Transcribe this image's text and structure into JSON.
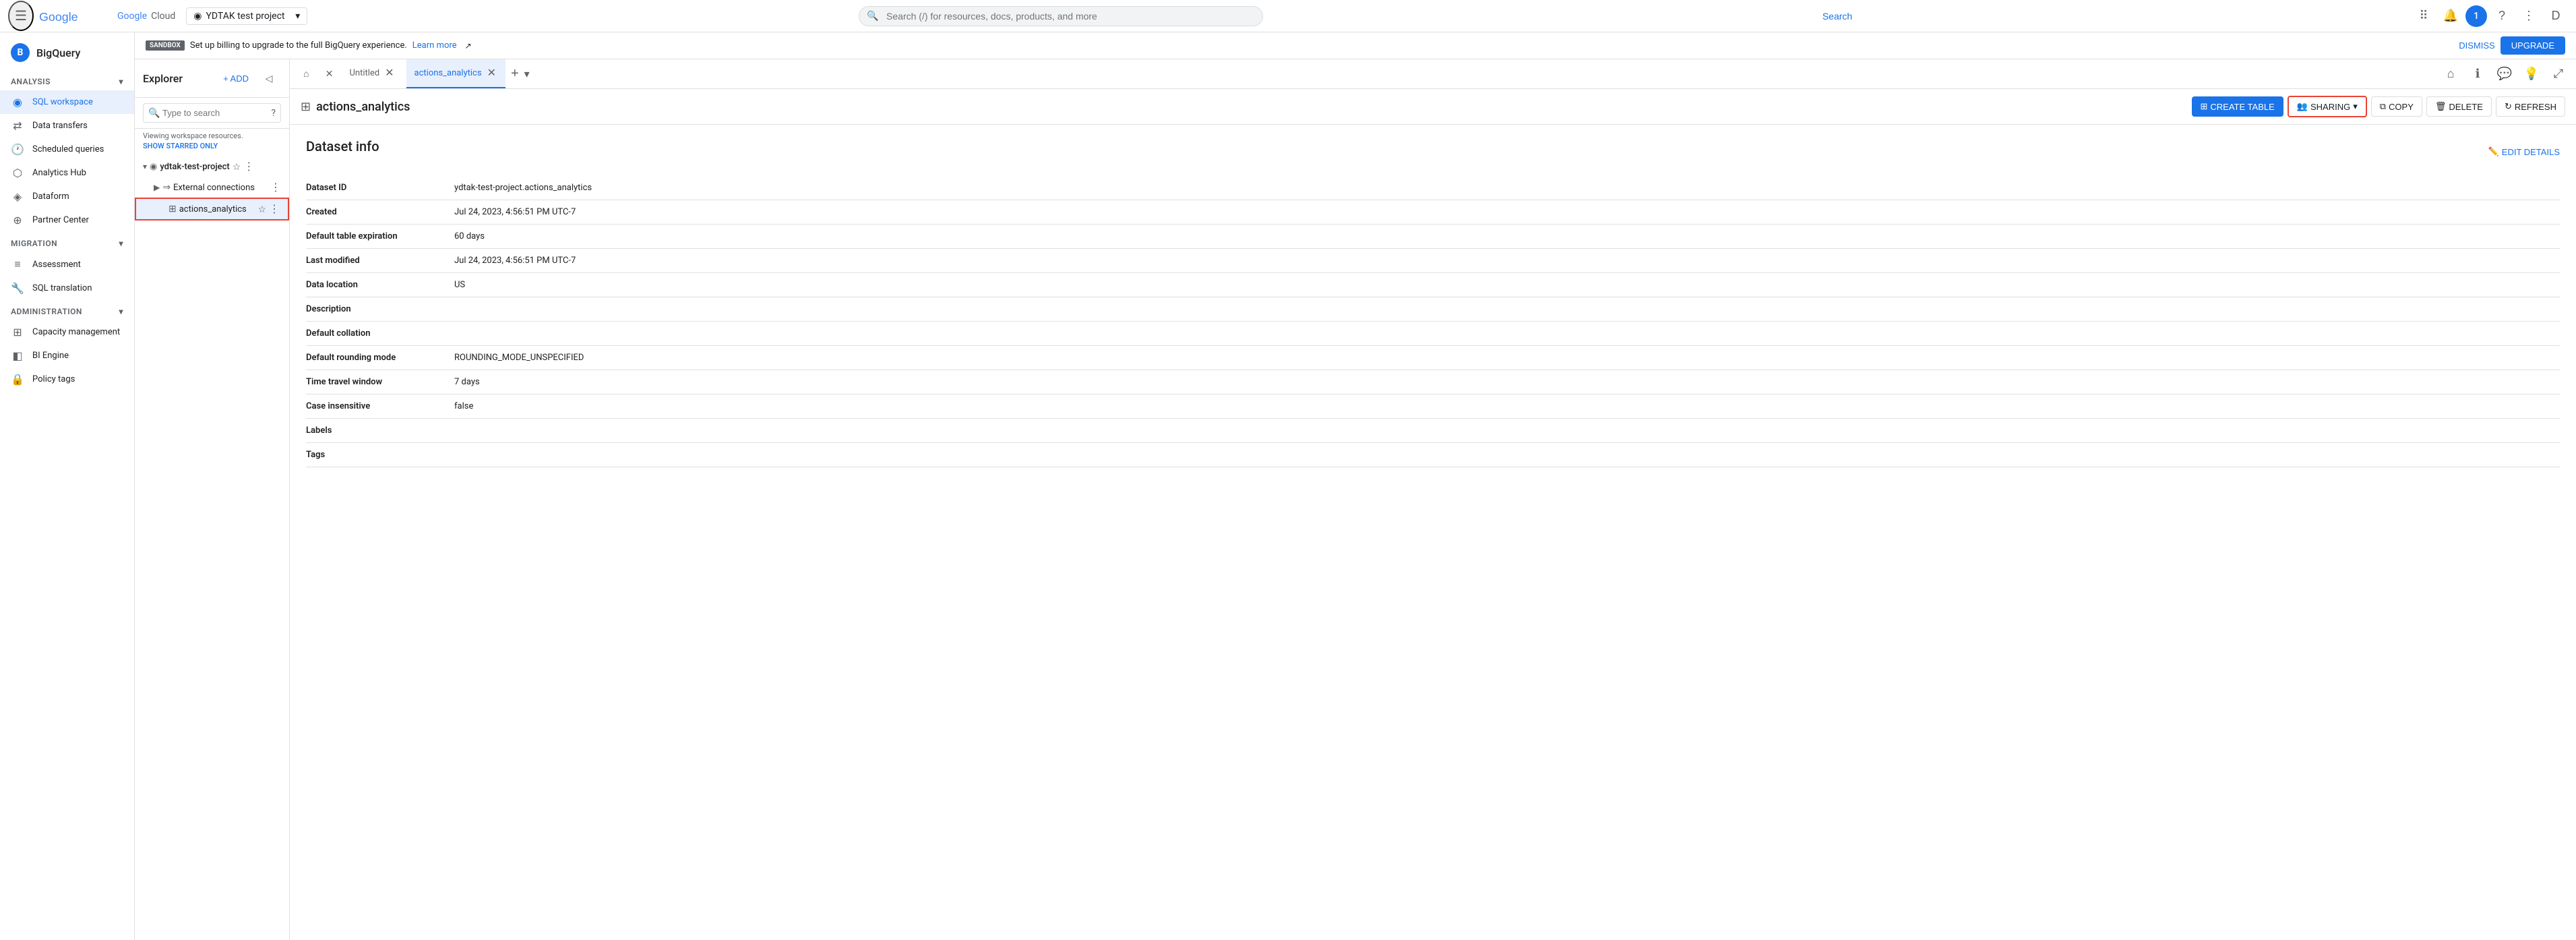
{
  "topbar": {
    "project_name": "YDTAK test project",
    "search_placeholder": "Search (/) for resources, docs, products, and more",
    "search_btn": "Search",
    "avatar_letter": "1"
  },
  "sandbox": {
    "badge": "SANDBOX",
    "message": "Set up billing to upgrade to the full BigQuery experience.",
    "learn_more": "Learn more",
    "dismiss": "DISMISS",
    "upgrade": "UPGRADE"
  },
  "sidebar": {
    "logo_letter": "B",
    "logo_text": "BigQuery",
    "sections": [
      {
        "id": "analysis",
        "label": "Analysis",
        "items": [
          {
            "id": "sql-workspace",
            "label": "SQL workspace",
            "icon": "◉",
            "active": true
          },
          {
            "id": "data-transfers",
            "label": "Data transfers",
            "icon": "⇄"
          },
          {
            "id": "scheduled-queries",
            "label": "Scheduled queries",
            "icon": "🕐"
          },
          {
            "id": "analytics-hub",
            "label": "Analytics Hub",
            "icon": "⬡"
          },
          {
            "id": "dataform",
            "label": "Dataform",
            "icon": "◈"
          },
          {
            "id": "partner-center",
            "label": "Partner Center",
            "icon": "⊕"
          }
        ]
      },
      {
        "id": "migration",
        "label": "Migration",
        "items": [
          {
            "id": "assessment",
            "label": "Assessment",
            "icon": "≡"
          },
          {
            "id": "sql-translation",
            "label": "SQL translation",
            "icon": "🔧"
          }
        ]
      },
      {
        "id": "administration",
        "label": "Administration",
        "items": [
          {
            "id": "capacity-management",
            "label": "Capacity management",
            "icon": "⊞"
          },
          {
            "id": "bi-engine",
            "label": "BI Engine",
            "icon": "◧"
          },
          {
            "id": "policy-tags",
            "label": "Policy tags",
            "icon": "🔒"
          }
        ]
      }
    ]
  },
  "explorer": {
    "title": "Explorer",
    "add_label": "+ ADD",
    "search_placeholder": "Type to search",
    "subtitle": "Viewing workspace resources.",
    "show_starred": "SHOW STARRED ONLY",
    "project": {
      "name": "ydtak-test-project",
      "items": [
        {
          "id": "external-connections",
          "label": "External connections",
          "icon": "⇒",
          "type": "connection"
        },
        {
          "id": "actions-analytics",
          "label": "actions_analytics",
          "icon": "⊞",
          "type": "dataset",
          "selected": true
        }
      ]
    }
  },
  "tabs": [
    {
      "id": "home",
      "type": "home",
      "icon": "⌂"
    },
    {
      "id": "untitled",
      "label": "Untitled",
      "closeable": true
    },
    {
      "id": "actions-analytics",
      "label": "actions_analytics",
      "closeable": true,
      "active": true
    }
  ],
  "tabs_right": {
    "home_icon": "⌂",
    "info_icon": "ℹ",
    "chat_icon": "💬",
    "bulb_icon": "💡",
    "expand_icon": "⤢"
  },
  "dataset": {
    "icon": "⊞",
    "title": "actions_analytics",
    "actions": {
      "create_table": "CREATE TABLE",
      "sharing": "SHARING",
      "copy": "COPY",
      "delete": "DELETE",
      "refresh": "REFRESH"
    },
    "edit_details": "EDIT DETAILS",
    "info_title": "Dataset info",
    "fields": [
      {
        "label": "Dataset ID",
        "value": "ydtak-test-project.actions_analytics"
      },
      {
        "label": "Created",
        "value": "Jul 24, 2023, 4:56:51 PM UTC-7"
      },
      {
        "label": "Default table expiration",
        "value": "60 days"
      },
      {
        "label": "Last modified",
        "value": "Jul 24, 2023, 4:56:51 PM UTC-7"
      },
      {
        "label": "Data location",
        "value": "US"
      },
      {
        "label": "Description",
        "value": ""
      },
      {
        "label": "Default collation",
        "value": ""
      },
      {
        "label": "Default rounding mode",
        "value": "ROUNDING_MODE_UNSPECIFIED"
      },
      {
        "label": "Time travel window",
        "value": "7 days"
      },
      {
        "label": "Case insensitive",
        "value": "false"
      },
      {
        "label": "Labels",
        "value": ""
      },
      {
        "label": "Tags",
        "value": ""
      }
    ]
  }
}
